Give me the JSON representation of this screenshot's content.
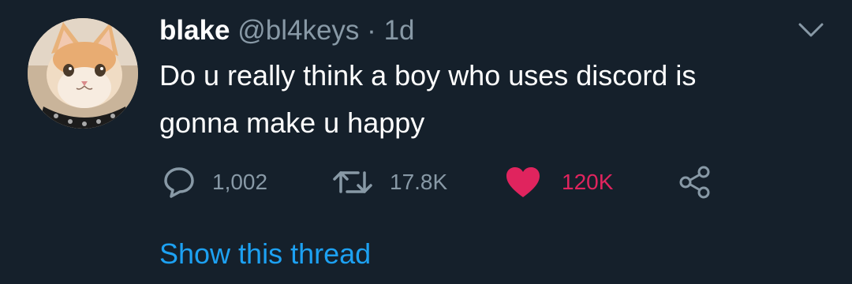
{
  "tweet": {
    "display_name": "blake",
    "handle": "@bl4keys",
    "separator": "·",
    "time": "1d",
    "body_line1": "Do u really think a boy who uses discord is",
    "body_line2": "gonna make u happy",
    "avatar": "cat-avatar",
    "stats": {
      "replies": "1,002",
      "retweets": "17.8K",
      "likes": "120K"
    },
    "show_thread": "Show this thread"
  },
  "icons": {
    "reply": "reply-icon",
    "retweet": "retweet-icon",
    "like": "heart-icon",
    "share": "share-icon",
    "menu": "chevron-down-icon"
  },
  "colors": {
    "background": "#15202b",
    "text": "#ffffff",
    "muted": "#8899a6",
    "like": "#e0245e",
    "link": "#1da1f2"
  }
}
